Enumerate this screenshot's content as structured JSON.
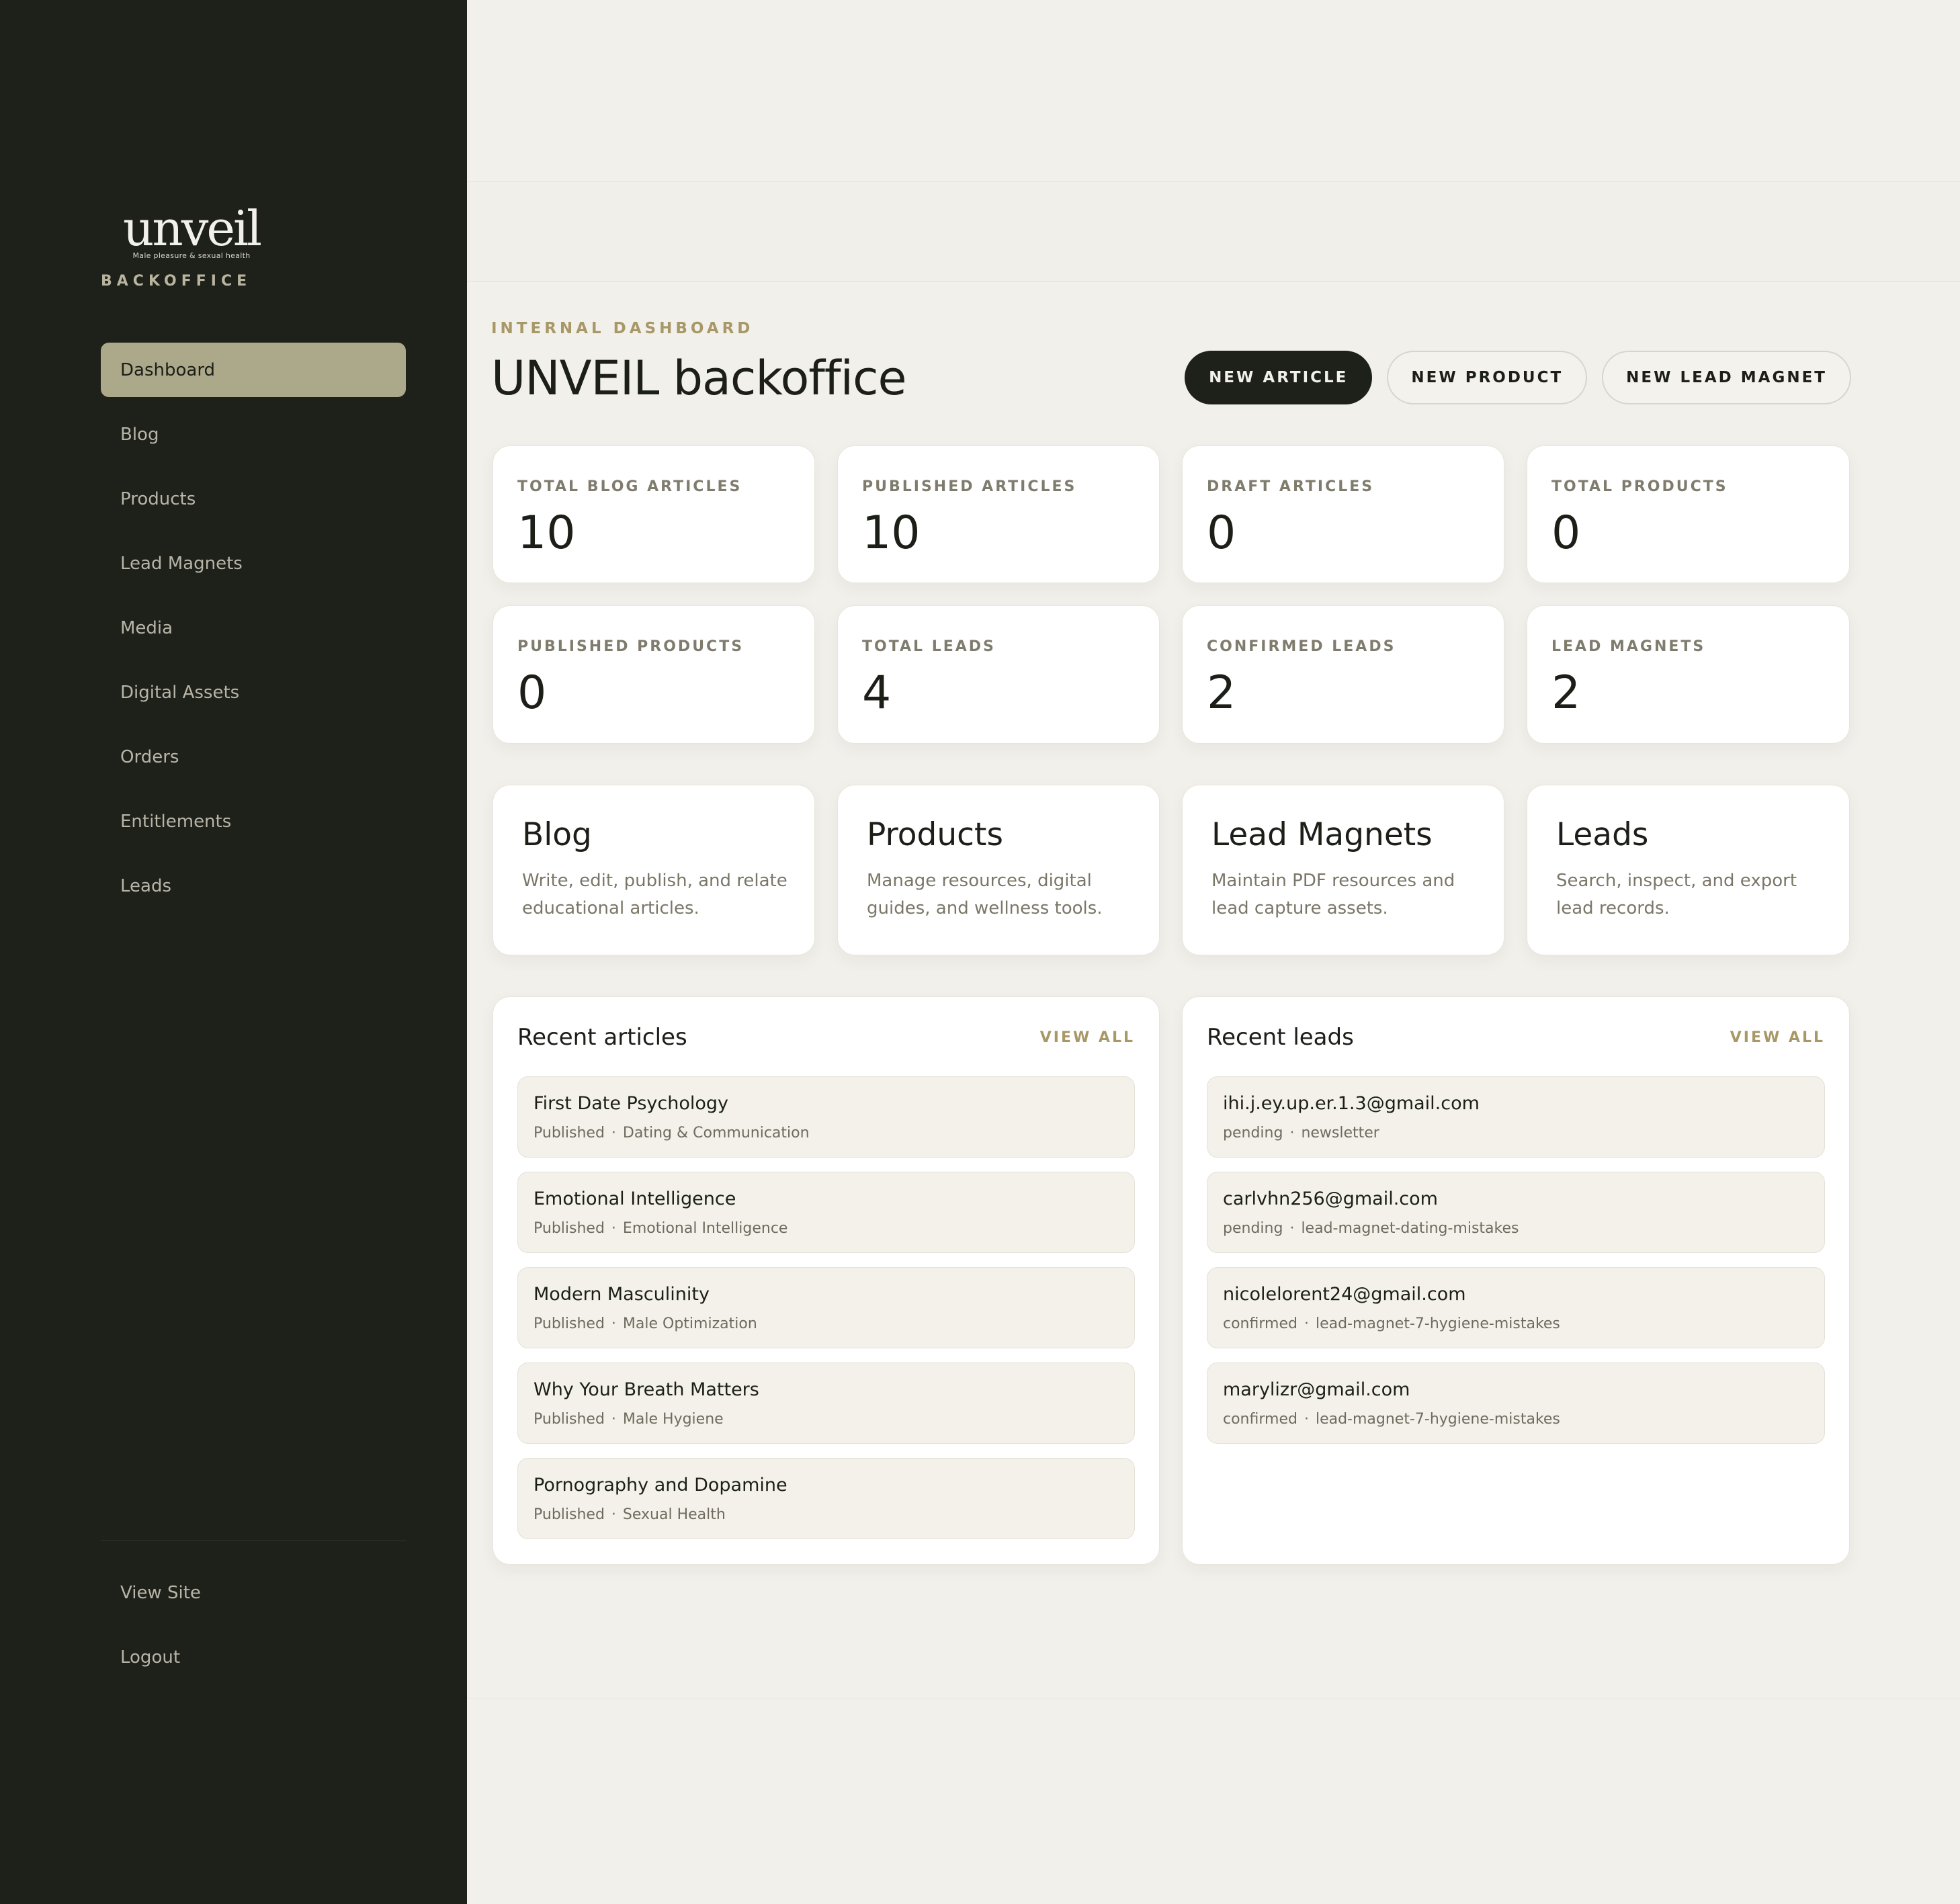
{
  "sidebar": {
    "logo": {
      "word": "unveil",
      "tagline": "Male pleasure & sexual health"
    },
    "section": "BACKOFFICE",
    "items": [
      {
        "label": "Dashboard",
        "active": true
      },
      {
        "label": "Blog"
      },
      {
        "label": "Products"
      },
      {
        "label": "Lead Magnets"
      },
      {
        "label": "Media"
      },
      {
        "label": "Digital Assets"
      },
      {
        "label": "Orders"
      },
      {
        "label": "Entitlements"
      },
      {
        "label": "Leads"
      }
    ],
    "bottom": [
      {
        "label": "View Site"
      },
      {
        "label": "Logout"
      }
    ]
  },
  "header": {
    "eyebrow": "INTERNAL DASHBOARD",
    "title": "UNVEIL backoffice",
    "actions": [
      "NEW ARTICLE",
      "NEW PRODUCT",
      "NEW LEAD MAGNET"
    ]
  },
  "stats": [
    {
      "label": "TOTAL BLOG ARTICLES",
      "value": "10"
    },
    {
      "label": "PUBLISHED ARTICLES",
      "value": "10"
    },
    {
      "label": "DRAFT ARTICLES",
      "value": "0"
    },
    {
      "label": "TOTAL PRODUCTS",
      "value": "0"
    },
    {
      "label": "PUBLISHED PRODUCTS",
      "value": "0"
    },
    {
      "label": "TOTAL LEADS",
      "value": "4"
    },
    {
      "label": "CONFIRMED LEADS",
      "value": "2"
    },
    {
      "label": "LEAD MAGNETS",
      "value": "2"
    }
  ],
  "modules": [
    {
      "title": "Blog",
      "desc": "Write, edit, publish, and relate educational articles."
    },
    {
      "title": "Products",
      "desc": "Manage resources, digital guides, and wellness tools."
    },
    {
      "title": "Lead Magnets",
      "desc": "Maintain PDF resources and lead capture assets."
    },
    {
      "title": "Leads",
      "desc": "Search, inspect, and export lead records."
    }
  ],
  "recent_articles": {
    "title": "Recent articles",
    "link": "VIEW ALL",
    "items": [
      {
        "title": "First Date Psychology",
        "status": "Published",
        "category": "Dating & Communication"
      },
      {
        "title": "Emotional Intelligence",
        "status": "Published",
        "category": "Emotional Intelligence"
      },
      {
        "title": "Modern Masculinity",
        "status": "Published",
        "category": "Male Optimization"
      },
      {
        "title": "Why Your Breath Matters",
        "status": "Published",
        "category": "Male Hygiene"
      },
      {
        "title": "Pornography and Dopamine",
        "status": "Published",
        "category": "Sexual Health"
      }
    ]
  },
  "recent_leads": {
    "title": "Recent leads",
    "link": "VIEW ALL",
    "items": [
      {
        "email": "ihi.j.ey.up.er.1.3@gmail.com",
        "status": "pending",
        "source": "newsletter"
      },
      {
        "email": "carlvhn256@gmail.com",
        "status": "pending",
        "source": "lead-magnet-dating-mistakes"
      },
      {
        "email": "nicolelorent24@gmail.com",
        "status": "confirmed",
        "source": "lead-magnet-7-hygiene-mistakes"
      },
      {
        "email": "marylizr@gmail.com",
        "status": "confirmed",
        "source": "lead-magnet-7-hygiene-mistakes"
      }
    ]
  },
  "colors": {
    "sidebar_bg": "#1e201a",
    "page_bg": "#f2f0ea",
    "accent": "#a89868",
    "active_nav": "#aca88a"
  }
}
